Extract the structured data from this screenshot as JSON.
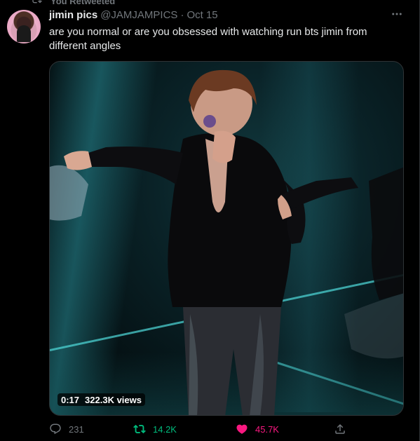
{
  "retweet_label": "You Retweeted",
  "author": {
    "name": "jimin pics",
    "handle": "@JAMJAMPICS",
    "separator": "·",
    "date": "Oct 15"
  },
  "tweet_text": "are you normal or are you obsessed with watching run bts jimin from different angles",
  "video": {
    "duration": "0:17",
    "views": "322.3K views"
  },
  "actions": {
    "replies": "231",
    "retweets": "14.2K",
    "likes": "45.7K"
  },
  "colors": {
    "background": "#000000",
    "secondary_text": "#71767b",
    "retweet_active": "#00ba7c",
    "like_active": "#f91880"
  },
  "icons": {
    "retweet_header": "retweet-icon",
    "more": "more-icon",
    "reply": "reply-icon",
    "retweet": "retweet-icon",
    "like": "heart-filled-icon",
    "share": "share-icon"
  }
}
